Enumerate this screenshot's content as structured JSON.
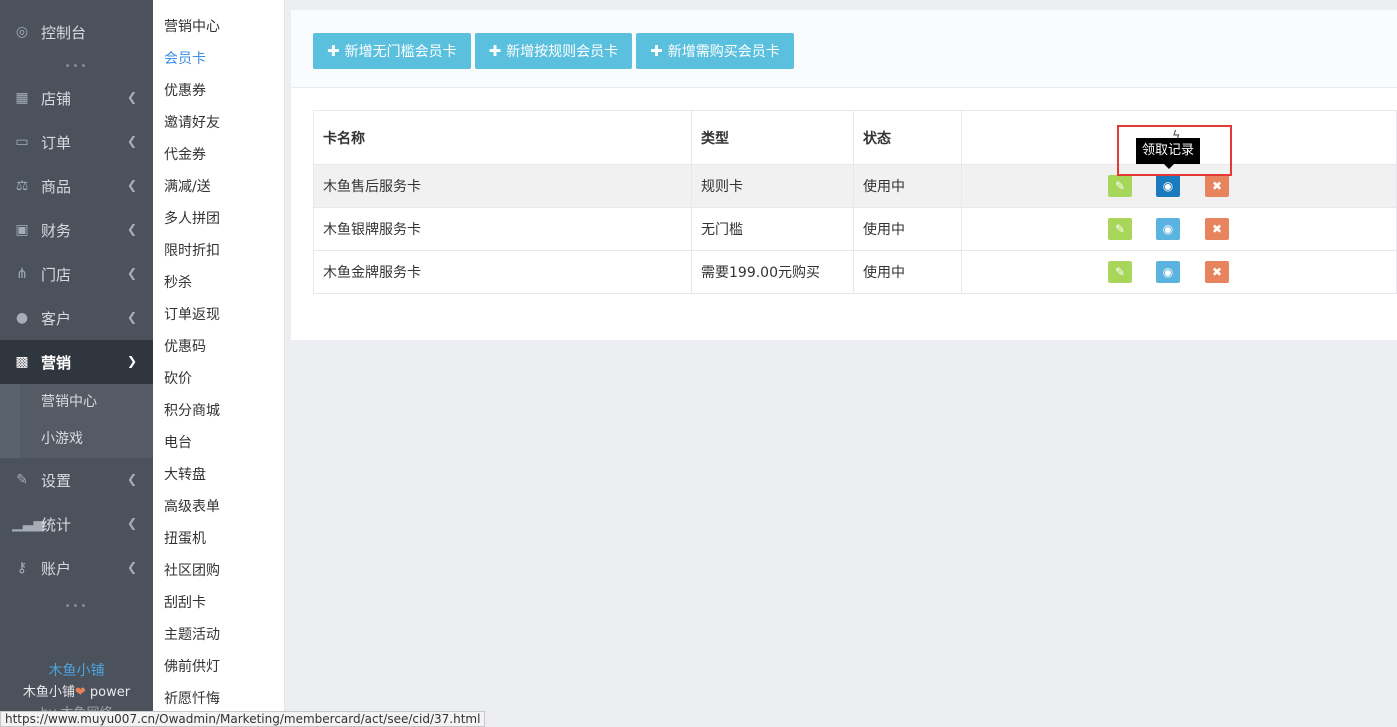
{
  "sidebar": {
    "top": {
      "label": "控制台",
      "icon": "dashboard-icon"
    },
    "items": [
      {
        "label": "店铺",
        "icon": "store-icon"
      },
      {
        "label": "订单",
        "icon": "order-icon"
      },
      {
        "label": "商品",
        "icon": "scale-icon"
      },
      {
        "label": "财务",
        "icon": "finance-icon"
      },
      {
        "label": "门店",
        "icon": "sitemap-icon"
      },
      {
        "label": "客户",
        "icon": "users-icon"
      }
    ],
    "active": {
      "label": "营销",
      "icon": "gift-icon"
    },
    "sub": [
      "营销中心",
      "小游戏"
    ],
    "items2": [
      {
        "label": "设置",
        "icon": "wrench-icon"
      },
      {
        "label": "统计",
        "icon": "bar-chart-icon"
      },
      {
        "label": "账户",
        "icon": "key-icon"
      }
    ],
    "footer": {
      "brand": "木鱼小铺",
      "power_prefix": "木鱼小铺",
      "power_suffix": " power",
      "by": "by 木鱼网络"
    }
  },
  "menu2": [
    "营销中心",
    "会员卡",
    "优惠券",
    "邀请好友",
    "代金券",
    "满减/送",
    "多人拼团",
    "限时折扣",
    "秒杀",
    "订单返现",
    "优惠码",
    "砍价",
    "积分商城",
    "电台",
    "大转盘",
    "高级表单",
    "扭蛋机",
    "社区团购",
    "刮刮卡",
    "主题活动",
    "佛前供灯",
    "祈愿忏悔"
  ],
  "menu2_current": "会员卡",
  "toolbar": {
    "buttons": [
      "新增无门槛会员卡",
      "新增按规则会员卡",
      "新增需购买会员卡"
    ]
  },
  "table": {
    "headers": [
      "卡名称",
      "类型",
      "状态",
      ""
    ],
    "rows": [
      {
        "name": "木鱼售后服务卡",
        "type": "规则卡",
        "status": "使用中"
      },
      {
        "name": "木鱼银牌服务卡",
        "type": "无门槛",
        "status": "使用中"
      },
      {
        "name": "木鱼金牌服务卡",
        "type": "需要199.00元购买",
        "status": "使用中"
      }
    ]
  },
  "tooltip": "领取记录",
  "statusbar": "https://www.muyu007.cn/Owadmin/Marketing/membercard/act/see/cid/37.html",
  "colors": {
    "sidebar": "#4b525b",
    "button": "#5bc0de",
    "edit": "#a7d65a",
    "view": "#5bb3e0",
    "delete": "#e7845e",
    "link": "#3a8ee6"
  }
}
